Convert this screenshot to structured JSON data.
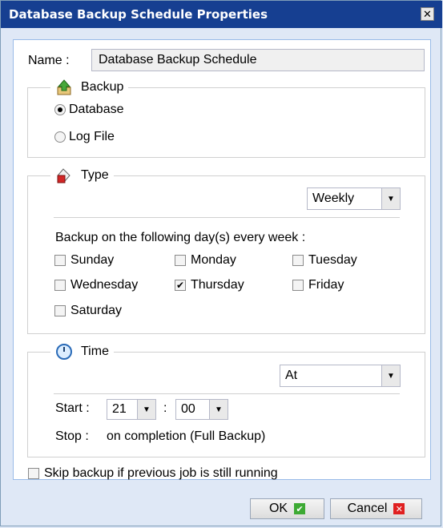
{
  "window": {
    "title": "Database Backup Schedule Properties",
    "close_glyph": "✕"
  },
  "name": {
    "label": "Name :",
    "value": "Database Backup Schedule"
  },
  "backup": {
    "legend": "Backup",
    "icon": "backup-upload-icon",
    "options": [
      {
        "label": "Database",
        "selected": true
      },
      {
        "label": "Log File",
        "selected": false
      }
    ]
  },
  "type": {
    "legend": "Type",
    "icon": "paint-bucket-icon",
    "frequency": "Weekly",
    "instruction": "Backup on the following day(s) every week :",
    "days": [
      {
        "label": "Sunday",
        "checked": false
      },
      {
        "label": "Monday",
        "checked": false
      },
      {
        "label": "Tuesday",
        "checked": false
      },
      {
        "label": "Wednesday",
        "checked": false
      },
      {
        "label": "Thursday",
        "checked": true
      },
      {
        "label": "Friday",
        "checked": false
      },
      {
        "label": "Saturday",
        "checked": false
      }
    ]
  },
  "time": {
    "legend": "Time",
    "icon": "clock-icon",
    "mode": "At",
    "start_label": "Start :",
    "start_hour": "21",
    "colon": ":",
    "start_minute": "00",
    "stop_label": "Stop :",
    "stop_value": "on completion (Full Backup)"
  },
  "skip": {
    "label": "Skip backup if previous job is still running",
    "checked": false
  },
  "buttons": {
    "ok": "OK",
    "cancel": "Cancel"
  },
  "colors": {
    "titlebar": "#163f91",
    "ok_mark": "#3daa34",
    "cancel_mark": "#e02020"
  }
}
